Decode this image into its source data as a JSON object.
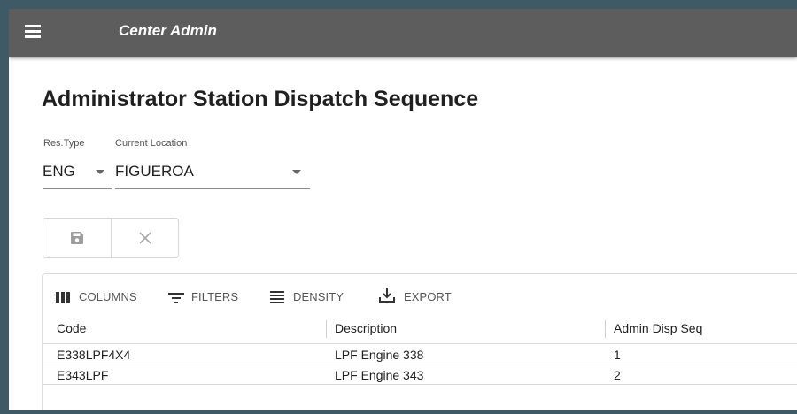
{
  "app": {
    "title": "Center Admin"
  },
  "page": {
    "title": "Administrator Station Dispatch Sequence"
  },
  "filters": {
    "res_type": {
      "label": "Res.Type",
      "value": "ENG"
    },
    "current_location": {
      "label": "Current Location",
      "value": "FIGUEROA"
    }
  },
  "actions": {
    "save_icon": "save-icon",
    "cancel_icon": "close-icon"
  },
  "toolbar": {
    "columns_label": "COLUMNS",
    "filters_label": "FILTERS",
    "density_label": "DENSITY",
    "export_label": "EXPORT"
  },
  "table": {
    "headers": [
      "Code",
      "Description",
      "Admin Disp Seq"
    ],
    "rows": [
      [
        "E338LPF4X4",
        "LPF Engine 338",
        "1"
      ],
      [
        "E343LPF",
        "LPF Engine 343",
        "2"
      ]
    ]
  },
  "colors": {
    "appbar": "#5d5d5d",
    "frame": "#3e5a66"
  }
}
